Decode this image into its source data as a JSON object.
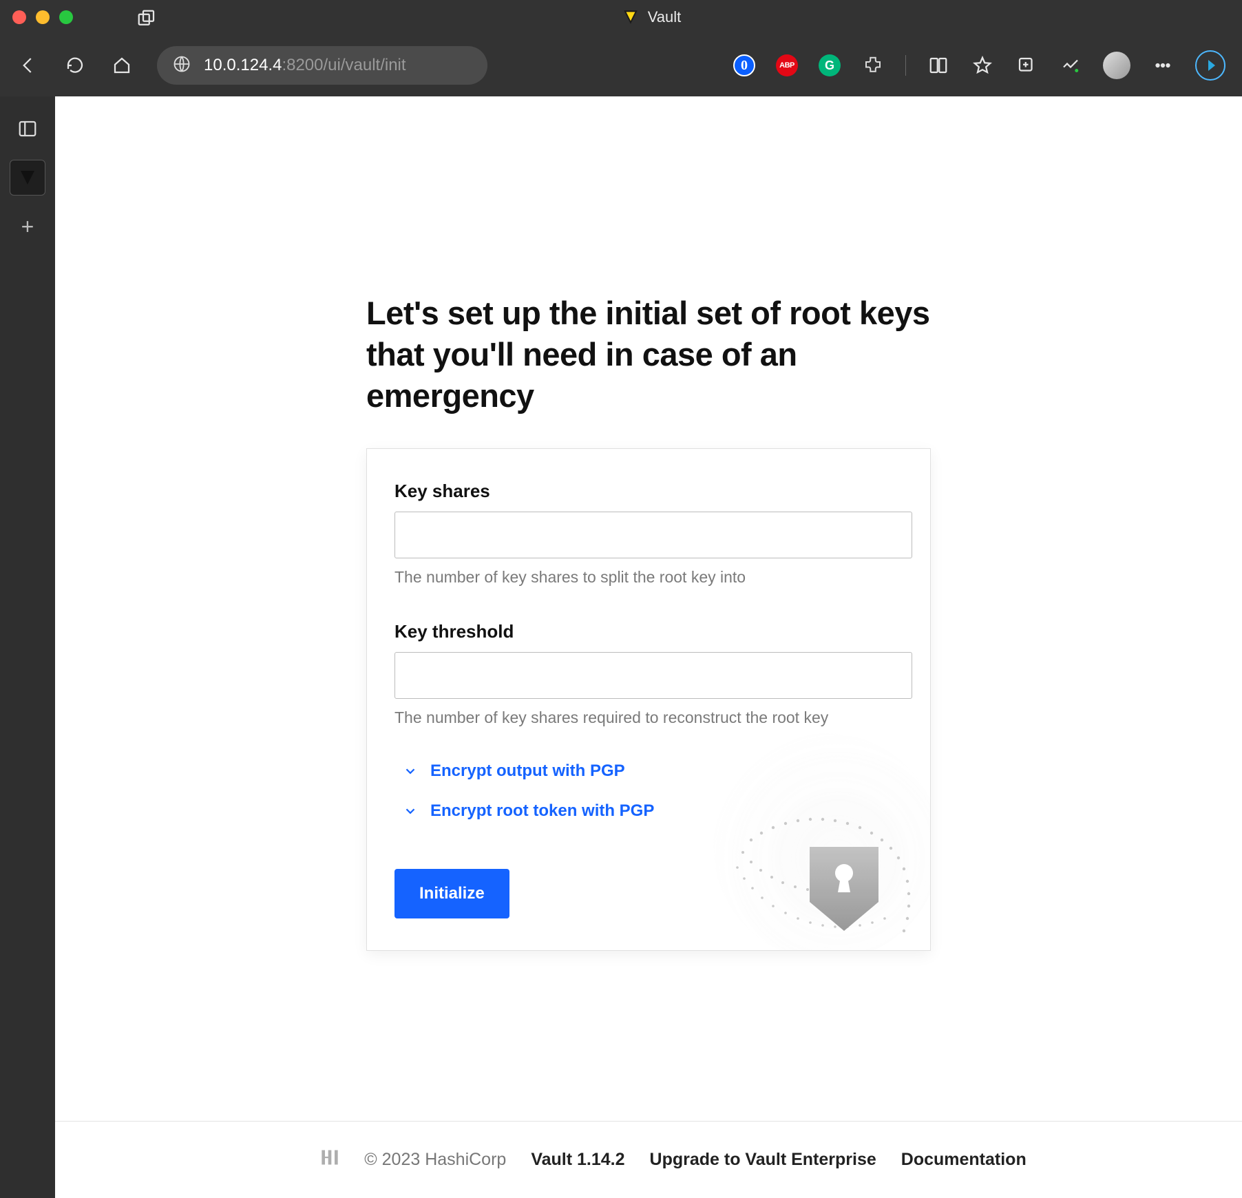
{
  "browser": {
    "tab_title": "Vault",
    "url_primary": "10.0.124.4",
    "url_secondary": ":8200/ui/vault/init"
  },
  "page": {
    "heading": "Let's set up the initial set of root keys that you'll need in case of an emergency",
    "key_shares_label": "Key shares",
    "key_shares_help": "The number of key shares to split the root key into",
    "key_threshold_label": "Key threshold",
    "key_threshold_help": "The number of key shares required to reconstruct the root key",
    "pgp_output": "Encrypt output with PGP",
    "pgp_root": "Encrypt root token with PGP",
    "initialize_btn": "Initialize"
  },
  "footer": {
    "copyright": "© 2023 HashiCorp",
    "version": "Vault 1.14.2",
    "upgrade": "Upgrade to Vault Enterprise",
    "documentation": "Documentation"
  }
}
